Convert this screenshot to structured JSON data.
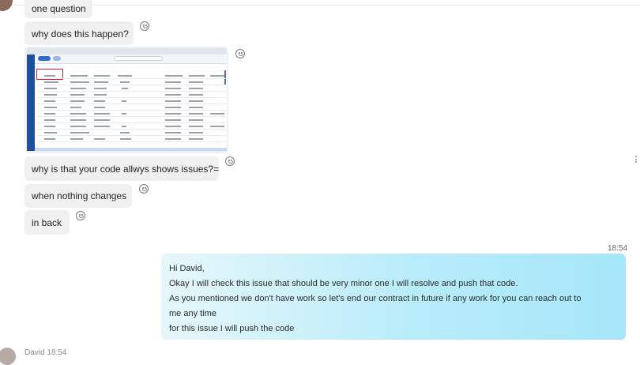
{
  "incoming_messages": [
    {
      "text": "one question"
    },
    {
      "text": "why does this happen?"
    },
    {
      "text": "why is that your code allwys shows issues?="
    },
    {
      "text": "when nothing changes"
    },
    {
      "text": "in back"
    }
  ],
  "outgoing": {
    "time": "18:54",
    "lines": [
      "Hi David,",
      "Okay I will check this issue that should be very minor one I will resolve and push that code.",
      "As you mentioned we don't have work so let's end our contract in future if any work for you can reach out to",
      "me any time",
      "for this issue I will push the code"
    ]
  },
  "next_message_header": "David  18:54",
  "icons": {
    "reaction": "smiley-reaction-icon",
    "more": "more-options-icon"
  },
  "colors": {
    "incoming_bubble": "#f0f0f0",
    "outgoing_bubble_start": "#e6f7fb",
    "outgoing_bubble_end": "#a6e6fa",
    "highlight_box": "#d0212b"
  }
}
